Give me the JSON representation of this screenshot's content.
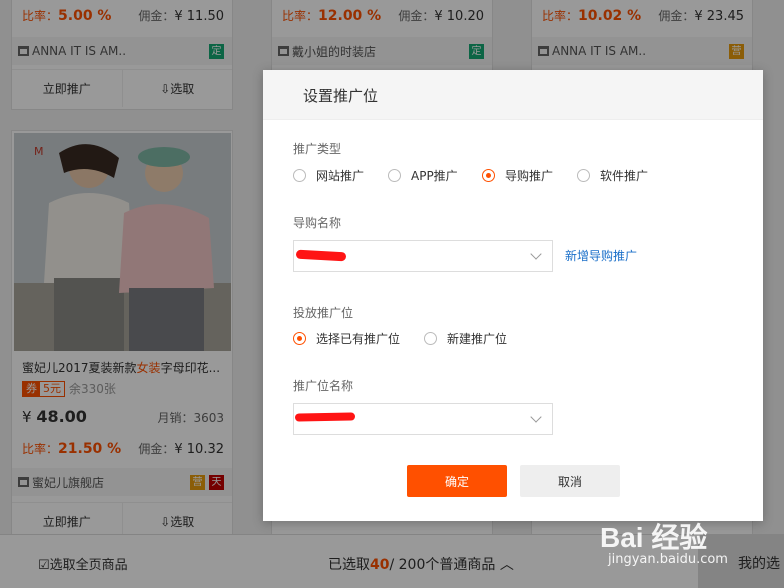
{
  "cards_top": [
    {
      "rate_label": "比率：",
      "rate_value": "5.00 %",
      "commission_label": "佣金：",
      "commission_value": "¥ 11.50",
      "shop": "ANNA IT IS AM..",
      "badge": "定",
      "btn_promote": "立即推广",
      "btn_select": "选取"
    },
    {
      "rate_label": "比率：",
      "rate_value": "12.00 %",
      "commission_label": "佣金：",
      "commission_value": "¥ 10.20",
      "shop": "戴小姐的时装店",
      "badge": "定"
    },
    {
      "rate_label": "比率：",
      "rate_value": "10.02 %",
      "commission_label": "佣金：",
      "commission_value": "¥ 23.45",
      "shop": "ANNA IT IS AM..",
      "badge": "营"
    }
  ],
  "product": {
    "title_a": "蜜妃儿2017夏装新款",
    "title_hl": "女装",
    "title_b": "字母印花...",
    "coupon_tag": "券",
    "coupon_value": "5元",
    "remaining": "余330张",
    "price_symbol": "¥",
    "price": "48.00",
    "sales": "月销：3603",
    "rate_label": "比率：",
    "rate_value": "21.50 %",
    "commission_label": "佣金：",
    "commission_value": "¥ 10.32",
    "shop": "蜜妃儿旗舰店",
    "badge": "营",
    "tmall_badge": "天",
    "btn_promote": "立即推广",
    "btn_select": "选取"
  },
  "bottom_bar": {
    "select_page": "选取全页商品",
    "selected_prefix": "已选取",
    "selected_count": "40",
    "selected_suffix": "/ 200个普通商品",
    "mine": "我的选"
  },
  "modal": {
    "title": "设置推广位",
    "promo_type_label": "推广类型",
    "promo_types": [
      "网站推广",
      "APP推广",
      "导购推广",
      "软件推广"
    ],
    "guide_name_label": "导购名称",
    "add_guide_link": "新增导购推广",
    "slot_label": "投放推广位",
    "slot_options": [
      "选择已有推广位",
      "新建推广位"
    ],
    "slot_name_label": "推广位名称",
    "confirm": "确定",
    "cancel": "取消"
  },
  "watermark": {
    "logo": "Bai 经验",
    "url": "jingyan.baidu.com"
  }
}
